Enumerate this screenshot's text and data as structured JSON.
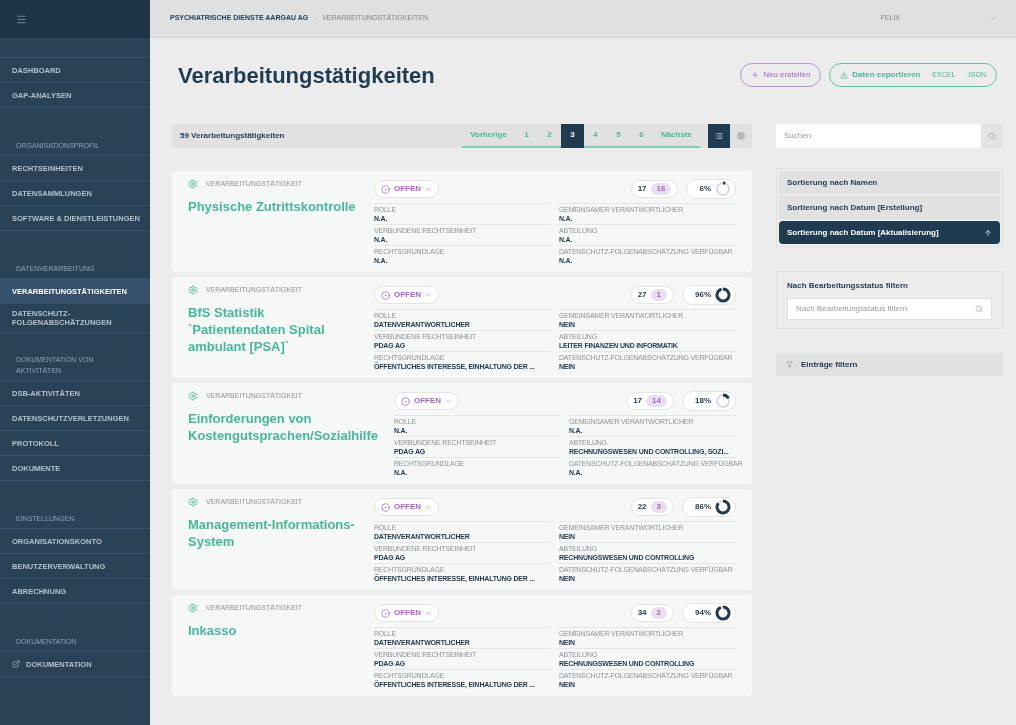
{
  "sidebar": {
    "sections": [
      {
        "items": [
          {
            "label": "DASHBOARD",
            "selected": false
          },
          {
            "label": "GAP-ANALYSEN",
            "selected": false
          }
        ]
      },
      {
        "heading": "ORGANISATIONSPROFIL",
        "items": [
          {
            "label": "RECHTSEINHEITEN",
            "selected": false
          },
          {
            "label": "DATENSAMMLUNGEN",
            "selected": false
          },
          {
            "label": "SOFTWARE & DIENSTLEISTUNGEN",
            "selected": false
          }
        ]
      },
      {
        "heading": "DATENVERARBEITUNG",
        "items": [
          {
            "label": "VERARBEITUNGSTÄTIGKEITEN",
            "selected": true
          },
          {
            "label": "DATENSCHUTZ-\nFOLGENABSCHÄTZUNGEN",
            "selected": false
          }
        ]
      },
      {
        "heading": "DOKUMENTATION VON AKTIVITÄTEN",
        "items": [
          {
            "label": "DSB-AKTIVITÄTEN",
            "selected": false
          },
          {
            "label": "DATENSCHUTZVERLETZUNGEN",
            "selected": false
          },
          {
            "label": "PROTOKOLL",
            "selected": false
          },
          {
            "label": "DOKUMENTE",
            "selected": false
          }
        ]
      },
      {
        "heading": "EINSTELLUNGEN",
        "items": [
          {
            "label": "ORGANISATIONSKONTO",
            "selected": false
          },
          {
            "label": "BENUTZERVERWALTUNG",
            "selected": false
          },
          {
            "label": "ABRECHNUNG",
            "selected": false
          }
        ]
      },
      {
        "heading": "DOKUMENTATION",
        "items": [
          {
            "label": "DOKUMENTATION",
            "selected": false,
            "kind": "external"
          }
        ]
      }
    ]
  },
  "breadcrumb": [
    "PSYCHIATRISCHE DIENSTE AARGAU AG",
    "VERARBEITUNGSTÄTIGKEITEN"
  ],
  "user": "FELIX",
  "title": "Verarbeitungstätigkeiten",
  "actions": {
    "create": "Neu erstellen",
    "export": "Daten exportieren",
    "formats": [
      "EXCEL",
      "JSON"
    ]
  },
  "list": {
    "count": "59 Verarbeitungstätigkeiten",
    "previous": "Vorherige",
    "next": "Nächste",
    "pages": [
      {
        "label": "1",
        "selected": false
      },
      {
        "label": "2",
        "selected": false
      },
      {
        "label": "3",
        "selected": true
      },
      {
        "label": "4",
        "selected": false
      },
      {
        "label": "5",
        "selected": false
      },
      {
        "label": "6",
        "selected": false
      }
    ],
    "views": [
      {
        "kind": "list",
        "selected": true
      },
      {
        "kind": "grid",
        "selected": false
      }
    ]
  },
  "cards": [
    {
      "type": "VERARBEITUNGSTÄTIGKEIT",
      "title": "Physische Zutrittskontrolle",
      "status": "OFFEN",
      "count_a": "17",
      "count_b": "16",
      "percent": "6%",
      "fields": [
        {
          "label": "ROLLE",
          "value": "N.A."
        },
        {
          "label": "GEMEINSAMER VERANTWORTLICHER",
          "value": "N.A."
        },
        {
          "label": "VERBUNDENE RECHTSEINHEIT",
          "value": "N.A."
        },
        {
          "label": "ABTEILUNG",
          "value": "N.A."
        },
        {
          "label": "RECHTSGRUNDLAGE",
          "value": "N.A."
        },
        {
          "label": "DATENSCHUTZ-FOLGENABSCHÄTZUNG VERFÜGBAR",
          "value": "N.A."
        }
      ]
    },
    {
      "type": "VERARBEITUNGSTÄTIGKEIT",
      "title": "BfS Statistik `Patientendaten Spital ambulant [PSA]`",
      "status": "OFFEN",
      "count_a": "27",
      "count_b": "1",
      "percent": "96%",
      "fields": [
        {
          "label": "ROLLE",
          "value": "DATENVERANTWORTLICHER"
        },
        {
          "label": "GEMEINSAMER VERANTWORTLICHER",
          "value": "NEIN"
        },
        {
          "label": "VERBUNDENE RECHTSEINHEIT",
          "value": "PDAG AG"
        },
        {
          "label": "ABTEILUNG",
          "value": "LEITER FINANZEN UND INFORMATIK"
        },
        {
          "label": "RECHTSGRUNDLAGE",
          "value": "ÖFFENTLICHES INTERESSE, EINHALTUNG DER ..."
        },
        {
          "label": "DATENSCHUTZ-FOLGENABSCHÄTZUNG VERFÜGBAR",
          "value": "NEIN"
        }
      ]
    },
    {
      "type": "VERARBEITUNGSTÄTIGKEIT",
      "title": "Einforderungen von Kostengutsprachen/Sozialhilfe",
      "status": "OFFEN",
      "count_a": "17",
      "count_b": "14",
      "percent": "18%",
      "fields": [
        {
          "label": "ROLLE",
          "value": "N.A."
        },
        {
          "label": "GEMEINSAMER VERANTWORTLICHER",
          "value": "N.A."
        },
        {
          "label": "VERBUNDENE RECHTSEINHEIT",
          "value": "PDAG AG"
        },
        {
          "label": "ABTEILUNG",
          "value": "RECHNUNGSWESEN UND CONTROLLING, SOZI..."
        },
        {
          "label": "RECHTSGRUNDLAGE",
          "value": "N.A."
        },
        {
          "label": "DATENSCHUTZ-FOLGENABSCHÄTZUNG VERFÜGBAR",
          "value": "N.A."
        }
      ]
    },
    {
      "type": "VERARBEITUNGSTÄTIGKEIT",
      "title": "Management-Informations-System",
      "status": "OFFEN",
      "count_a": "22",
      "count_b": "3",
      "percent": "86%",
      "fields": [
        {
          "label": "ROLLE",
          "value": "DATENVERANTWORTLICHER"
        },
        {
          "label": "GEMEINSAMER VERANTWORTLICHER",
          "value": "NEIN"
        },
        {
          "label": "VERBUNDENE RECHTSEINHEIT",
          "value": "PDAG AG"
        },
        {
          "label": "ABTEILUNG",
          "value": "RECHNUNGSWESEN UND CONTROLLING"
        },
        {
          "label": "RECHTSGRUNDLAGE",
          "value": "ÖFFENTLICHES INTERESSE, EINHALTUNG DER ..."
        },
        {
          "label": "DATENSCHUTZ-FOLGENABSCHÄTZUNG VERFÜGBAR",
          "value": "NEIN"
        }
      ]
    },
    {
      "type": "VERARBEITUNGSTÄTIGKEIT",
      "title": "Inkasso",
      "status": "OFFEN",
      "count_a": "34",
      "count_b": "2",
      "percent": "94%",
      "fields": [
        {
          "label": "ROLLE",
          "value": "DATENVERANTWORTLICHER"
        },
        {
          "label": "GEMEINSAMER VERANTWORTLICHER",
          "value": "NEIN"
        },
        {
          "label": "VERBUNDENE RECHTSEINHEIT",
          "value": "PDAG AG"
        },
        {
          "label": "ABTEILUNG",
          "value": "RECHNUNGSWESEN UND CONTROLLING"
        },
        {
          "label": "RECHTSGRUNDLAGE",
          "value": "ÖFFENTLICHES INTERESSE, EINHALTUNG DER ..."
        },
        {
          "label": "DATENSCHUTZ-FOLGENABSCHÄTZUNG VERFÜGBAR",
          "value": "NEIN"
        }
      ]
    }
  ],
  "search": {
    "placeholder": "Suchen"
  },
  "sort_options": [
    {
      "label": "Sortierung nach Namen",
      "selected": false
    },
    {
      "label": "Sortierung nach Datum [Erstellung]",
      "selected": false
    },
    {
      "label": "Sortierung nach Datum [Aktualisierung]",
      "selected": true
    }
  ],
  "status_filter": {
    "label": "Nach Bearbeitungsstatus filtern",
    "placeholder": "Nach Bearbeitungsstatus filtern"
  },
  "entries_filter": {
    "label": "Einträge filtern",
    "expanded": false
  }
}
